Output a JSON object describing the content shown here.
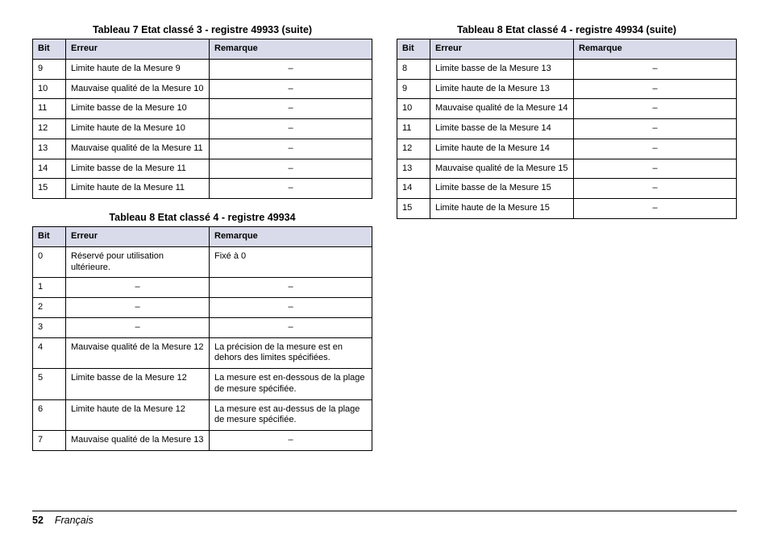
{
  "headers": {
    "bit": "Bit",
    "erreur": "Erreur",
    "remarque": "Remarque"
  },
  "tables": {
    "t7": {
      "caption": "Tableau 7  Etat classé 3 - registre 49933 (suite)",
      "rows": [
        {
          "bit": "9",
          "err": "Limite haute de la Mesure 9",
          "rem": "–"
        },
        {
          "bit": "10",
          "err": "Mauvaise qualité de la Mesure 10",
          "rem": "–"
        },
        {
          "bit": "11",
          "err": "Limite basse de la Mesure 10",
          "rem": "–"
        },
        {
          "bit": "12",
          "err": "Limite haute de la Mesure 10",
          "rem": "–"
        },
        {
          "bit": "13",
          "err": "Mauvaise qualité de la Mesure 11",
          "rem": "–"
        },
        {
          "bit": "14",
          "err": "Limite basse de la Mesure 11",
          "rem": "–"
        },
        {
          "bit": "15",
          "err": "Limite haute de la Mesure 11",
          "rem": "–"
        }
      ]
    },
    "t8a": {
      "caption": "Tableau 8  Etat classé 4 - registre 49934",
      "rows": [
        {
          "bit": "0",
          "err": "Réservé pour utilisation ultérieure.",
          "rem": "Fixé à 0"
        },
        {
          "bit": "1",
          "err": "–",
          "rem": "–"
        },
        {
          "bit": "2",
          "err": "–",
          "rem": "–"
        },
        {
          "bit": "3",
          "err": "–",
          "rem": "–"
        },
        {
          "bit": "4",
          "err": "Mauvaise qualité de la Mesure 12",
          "rem": "La précision de la mesure est en dehors des limites spécifiées."
        },
        {
          "bit": "5",
          "err": "Limite basse de la Mesure 12",
          "rem": "La mesure est en-dessous de la plage de mesure spécifiée."
        },
        {
          "bit": "6",
          "err": "Limite haute de la Mesure 12",
          "rem": "La mesure est au-dessus de la plage de mesure spécifiée."
        },
        {
          "bit": "7",
          "err": "Mauvaise qualité de la Mesure 13",
          "rem": "–"
        }
      ]
    },
    "t8b": {
      "caption": "Tableau 8  Etat classé 4 - registre 49934 (suite)",
      "rows": [
        {
          "bit": "8",
          "err": "Limite basse de la Mesure 13",
          "rem": "–"
        },
        {
          "bit": "9",
          "err": "Limite haute de la Mesure 13",
          "rem": "–"
        },
        {
          "bit": "10",
          "err": "Mauvaise qualité de la Mesure 14",
          "rem": "–"
        },
        {
          "bit": "11",
          "err": "Limite basse de la Mesure 14",
          "rem": "–"
        },
        {
          "bit": "12",
          "err": "Limite haute de la Mesure 14",
          "rem": "–"
        },
        {
          "bit": "13",
          "err": "Mauvaise qualité de la Mesure 15",
          "rem": "–"
        },
        {
          "bit": "14",
          "err": "Limite basse de la Mesure 15",
          "rem": "–"
        },
        {
          "bit": "15",
          "err": "Limite haute de la Mesure 15",
          "rem": "–"
        }
      ]
    }
  },
  "dash_rows_t8a": [
    "1",
    "2",
    "3"
  ],
  "footer": {
    "page": "52",
    "lang": "Français"
  }
}
